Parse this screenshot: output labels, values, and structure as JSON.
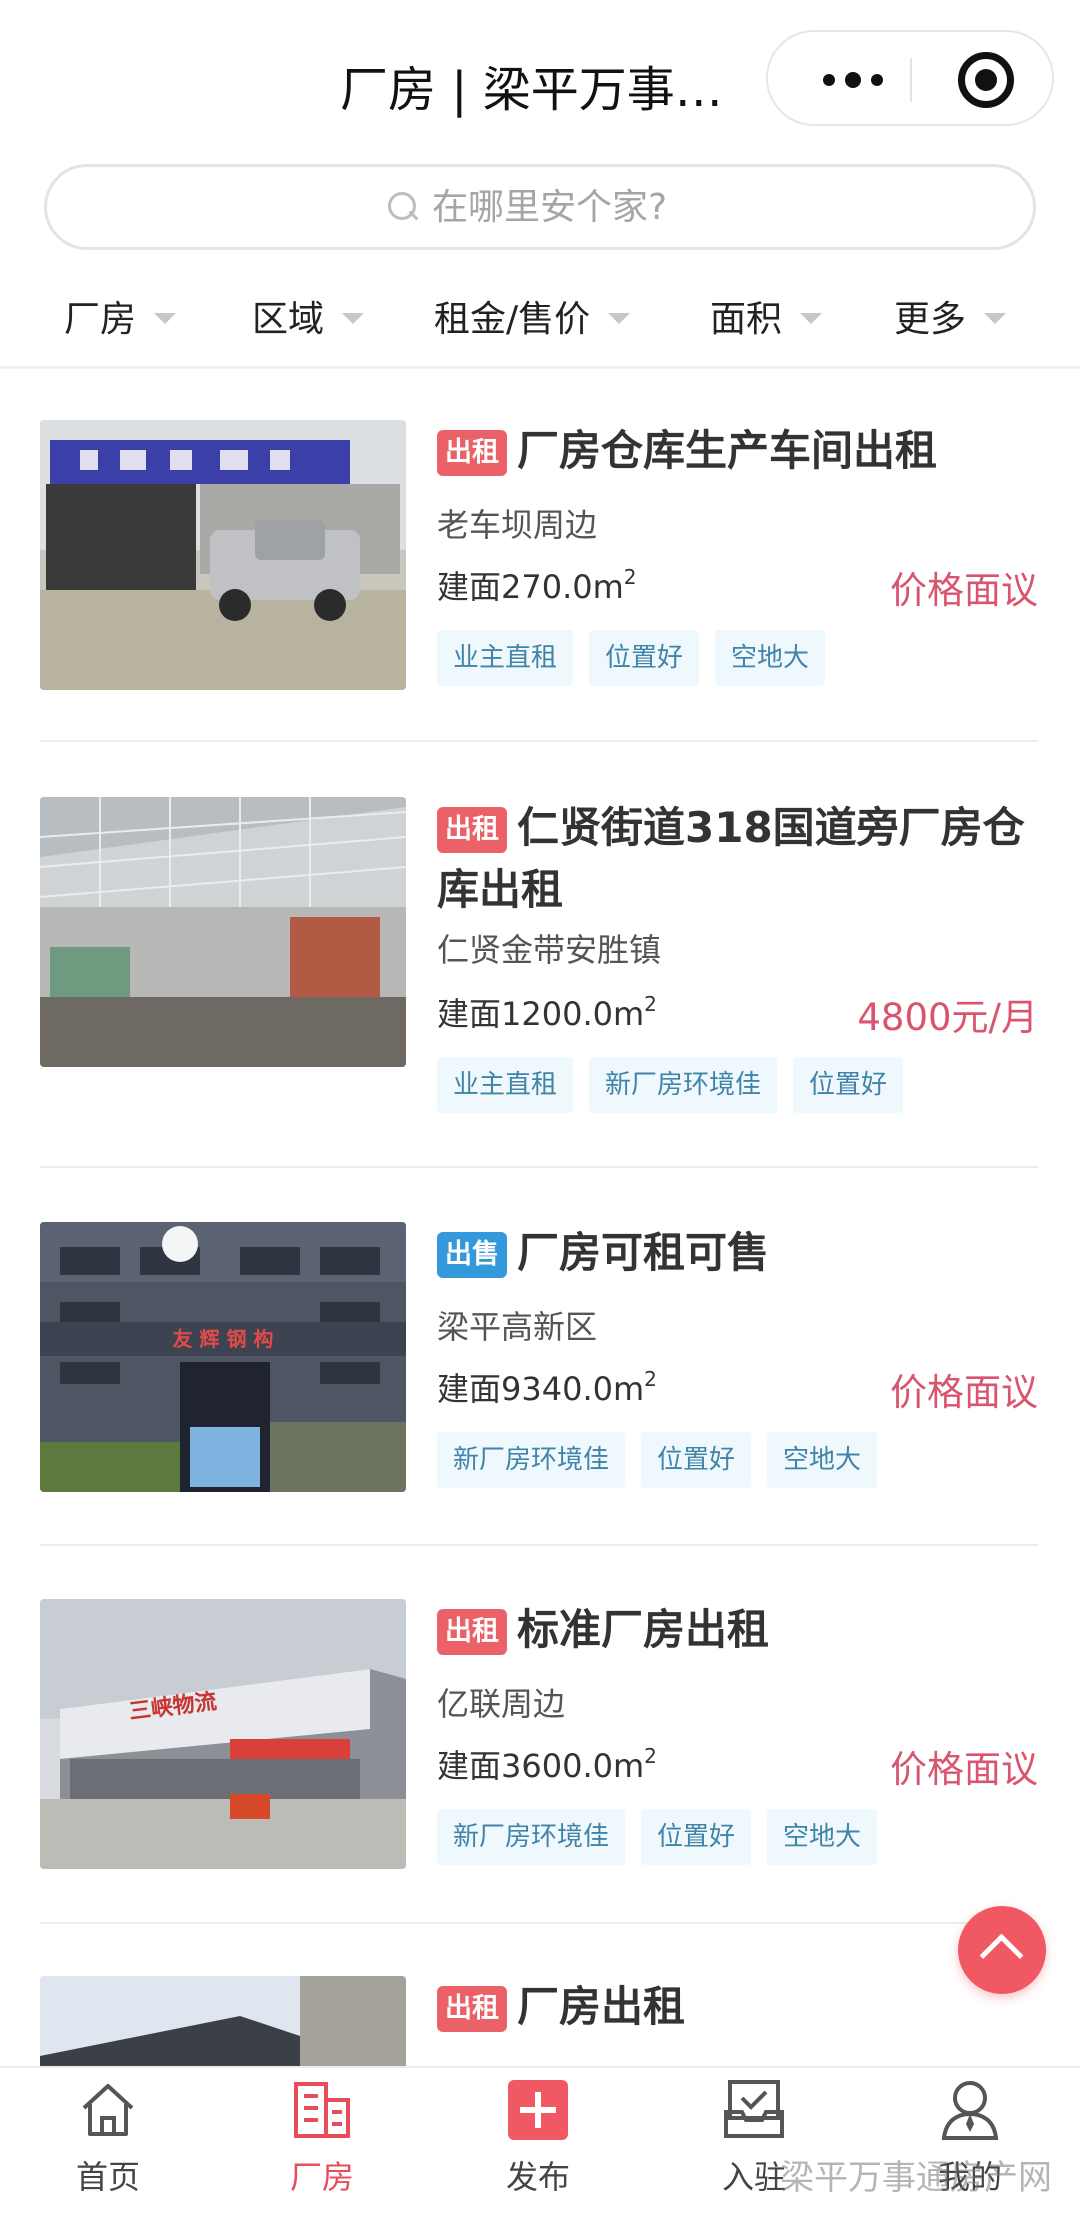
{
  "header": {
    "title": "厂房 | 梁平万事…"
  },
  "search": {
    "placeholder": "在哪里安个家?"
  },
  "filters": [
    {
      "label": "厂房"
    },
    {
      "label": "区域"
    },
    {
      "label": "租金/售价"
    },
    {
      "label": "面积"
    },
    {
      "label": "更多"
    }
  ],
  "listings": [
    {
      "badge": "出租",
      "badge_type": "rent",
      "title": "厂房仓库生产车间出租",
      "location": "老车坝周边",
      "area_prefix": "建面270.0m",
      "area_sup": "2",
      "price": "价格面议",
      "tags": [
        "业主直租",
        "位置好",
        "空地大"
      ]
    },
    {
      "badge": "出租",
      "badge_type": "rent",
      "title": "仁贤街道318国道旁厂房仓库出租",
      "location": "仁贤金带安胜镇",
      "area_prefix": "建面1200.0m",
      "area_sup": "2",
      "price": "4800元/月",
      "tags": [
        "业主直租",
        "新厂房环境佳",
        "位置好"
      ]
    },
    {
      "badge": "出售",
      "badge_type": "sale",
      "title": "厂房可租可售",
      "location": "梁平高新区",
      "area_prefix": "建面9340.0m",
      "area_sup": "2",
      "price": "价格面议",
      "tags": [
        "新厂房环境佳",
        "位置好",
        "空地大"
      ]
    },
    {
      "badge": "出租",
      "badge_type": "rent",
      "title": "标准厂房出租",
      "location": "亿联周边",
      "area_prefix": "建面3600.0m",
      "area_sup": "2",
      "price": "价格面议",
      "tags": [
        "新厂房环境佳",
        "位置好",
        "空地大"
      ]
    },
    {
      "badge": "出租",
      "badge_type": "rent",
      "title": "厂房出租",
      "location": "",
      "area_prefix": "",
      "area_sup": "",
      "price": "",
      "tags": []
    }
  ],
  "photo_signs": {
    "listing3_sign": "友 辉 钢 构",
    "listing4_sign": "三峡物流"
  },
  "tabbar": [
    {
      "label": "首页",
      "icon": "home-icon",
      "active": false
    },
    {
      "label": "厂房",
      "icon": "building-icon",
      "active": true
    },
    {
      "label": "发布",
      "icon": "publish-plus-icon",
      "active": false
    },
    {
      "label": "入驻",
      "icon": "checkin-icon",
      "active": false
    },
    {
      "label": "我的",
      "icon": "profile-icon",
      "active": false
    }
  ],
  "watermark": "梁平万事通房产网",
  "colors": {
    "accent": "#e84d5c",
    "rent_badge": "#ea6168",
    "sale_badge": "#3399db",
    "price": "#d9556e",
    "tag_bg": "#eff8fd",
    "tag_text": "#4184a8"
  }
}
